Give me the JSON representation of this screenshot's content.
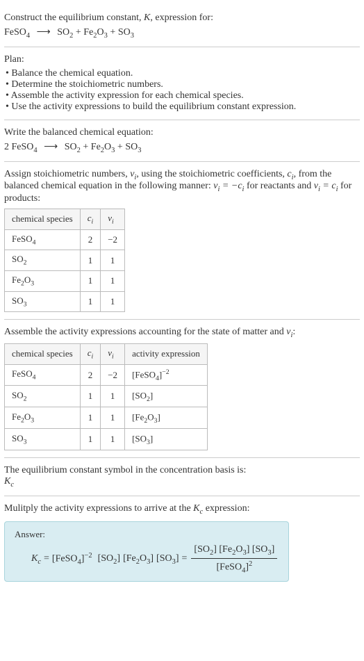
{
  "s1": {
    "line1_a": "Construct the equilibrium constant, ",
    "line1_k": "K",
    "line1_b": ", expression for:",
    "eq_lhs": "FeSO",
    "eq_lhs_sub": "4",
    "arrow": "⟶",
    "eq_r1": "SO",
    "eq_r1_sub": "2",
    "plus": " + ",
    "eq_r2a": "Fe",
    "eq_r2a_sub": "2",
    "eq_r2b": "O",
    "eq_r2b_sub": "3",
    "eq_r3": "SO",
    "eq_r3_sub": "3"
  },
  "s2": {
    "heading": "Plan:",
    "items": [
      "• Balance the chemical equation.",
      "• Determine the stoichiometric numbers.",
      "• Assemble the activity expression for each chemical species.",
      "• Use the activity expressions to build the equilibrium constant expression."
    ]
  },
  "s3": {
    "heading": "Write the balanced chemical equation:",
    "coef": "2 ",
    "eq_lhs": "FeSO",
    "eq_lhs_sub": "4",
    "arrow": "⟶",
    "eq_r1": "SO",
    "eq_r1_sub": "2",
    "plus": " + ",
    "eq_r2a": "Fe",
    "eq_r2a_sub": "2",
    "eq_r2b": "O",
    "eq_r2b_sub": "3",
    "eq_r3": "SO",
    "eq_r3_sub": "3"
  },
  "s4": {
    "text_a": "Assign stoichiometric numbers, ",
    "nu_i": "ν",
    "nu_sub": "i",
    "text_b": ", using the stoichiometric coefficients, ",
    "c_i": "c",
    "text_c": ", from the balanced chemical equation in the following manner: ",
    "rel1a": "ν",
    "rel1b": " = −",
    "rel1c": "c",
    "text_d": " for reactants and ",
    "rel2a": "ν",
    "rel2b": " = ",
    "rel2c": "c",
    "text_e": " for products:",
    "headers": {
      "h1": "chemical species",
      "h2": "c",
      "h2_sub": "i",
      "h3": "ν",
      "h3_sub": "i"
    },
    "rows": [
      {
        "sp_a": "FeSO",
        "sp_a_sub": "4",
        "sp_b": "",
        "sp_b_sub": "",
        "ci": "2",
        "nui": "−2"
      },
      {
        "sp_a": "SO",
        "sp_a_sub": "2",
        "sp_b": "",
        "sp_b_sub": "",
        "ci": "1",
        "nui": "1"
      },
      {
        "sp_a": "Fe",
        "sp_a_sub": "2",
        "sp_b": "O",
        "sp_b_sub": "3",
        "ci": "1",
        "nui": "1"
      },
      {
        "sp_a": "SO",
        "sp_a_sub": "3",
        "sp_b": "",
        "sp_b_sub": "",
        "ci": "1",
        "nui": "1"
      }
    ]
  },
  "s5": {
    "text_a": "Assemble the activity expressions accounting for the state of matter and ",
    "nu": "ν",
    "nu_sub": "i",
    "text_b": ":",
    "headers": {
      "h1": "chemical species",
      "h2": "c",
      "h2_sub": "i",
      "h3": "ν",
      "h3_sub": "i",
      "h4": "activity expression"
    },
    "rows": [
      {
        "sp_a": "FeSO",
        "sp_a_sub": "4",
        "sp_b": "",
        "sp_b_sub": "",
        "ci": "2",
        "nui": "−2",
        "ae_a": "[FeSO",
        "ae_a_sub": "4",
        "ae_b": "]",
        "ae_sup": "−2",
        "ae_c": "",
        "ae_c_sub": "",
        "ae_d": ""
      },
      {
        "sp_a": "SO",
        "sp_a_sub": "2",
        "sp_b": "",
        "sp_b_sub": "",
        "ci": "1",
        "nui": "1",
        "ae_a": "[SO",
        "ae_a_sub": "2",
        "ae_b": "]",
        "ae_sup": "",
        "ae_c": "",
        "ae_c_sub": "",
        "ae_d": ""
      },
      {
        "sp_a": "Fe",
        "sp_a_sub": "2",
        "sp_b": "O",
        "sp_b_sub": "3",
        "ci": "1",
        "nui": "1",
        "ae_a": "[Fe",
        "ae_a_sub": "2",
        "ae_b": "",
        "ae_sup": "",
        "ae_c": "O",
        "ae_c_sub": "3",
        "ae_d": "]"
      },
      {
        "sp_a": "SO",
        "sp_a_sub": "3",
        "sp_b": "",
        "sp_b_sub": "",
        "ci": "1",
        "nui": "1",
        "ae_a": "[SO",
        "ae_a_sub": "3",
        "ae_b": "]",
        "ae_sup": "",
        "ae_c": "",
        "ae_c_sub": "",
        "ae_d": ""
      }
    ]
  },
  "s6": {
    "line1": "The equilibrium constant symbol in the concentration basis is:",
    "sym": "K",
    "sym_sub": "c"
  },
  "s7": {
    "text_a": "Mulitply the activity expressions to arrive at the ",
    "kc": "K",
    "kc_sub": "c",
    "text_b": " expression:"
  },
  "ans": {
    "label": "Answer:",
    "kc": "K",
    "kc_sub": "c",
    "eq": " = ",
    "t1": "[FeSO",
    "t1_sub": "4",
    "t1b": "]",
    "t1_sup": "−2",
    "sp": " ",
    "t2": "[SO",
    "t2_sub": "2",
    "t2b": "] ",
    "t3a": "[Fe",
    "t3a_sub": "2",
    "t3b": "O",
    "t3b_sub": "3",
    "t3c": "] ",
    "t4": "[SO",
    "t4_sub": "3",
    "t4b": "]",
    "eq2": " = ",
    "num_a": "[SO",
    "num_a_sub": "2",
    "num_b": "] [Fe",
    "num_b_sub": "2",
    "num_c": "O",
    "num_c_sub": "3",
    "num_d": "] [SO",
    "num_d_sub": "3",
    "num_e": "]",
    "den_a": "[FeSO",
    "den_a_sub": "4",
    "den_b": "]",
    "den_sup": "2"
  }
}
